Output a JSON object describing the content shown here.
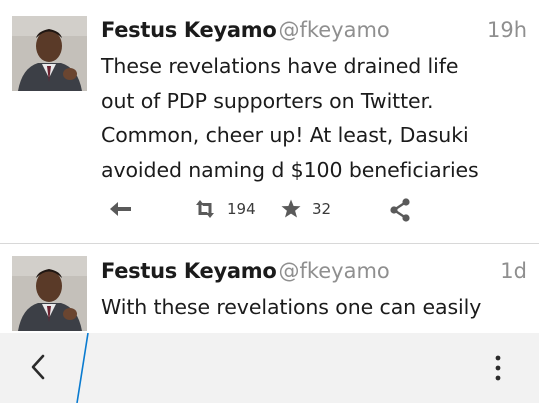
{
  "tweets": [
    {
      "name": "Festus Keyamo",
      "handle": "@fkeyamo",
      "time": "19h",
      "lines": [
        "These revelations have drained life",
        "out of PDP supporters on Twitter.",
        "Common, cheer up! At least, Dasuki",
        "avoided naming d $100 beneficiaries"
      ],
      "retweets": "194",
      "favorites": "32"
    },
    {
      "name": "Festus Keyamo",
      "handle": "@fkeyamo",
      "time": "1d",
      "lines": [
        "With these revelations one can easily"
      ]
    }
  ],
  "icons": {
    "reply": "reply-icon",
    "retweet": "retweet-icon",
    "favorite": "star-icon",
    "share": "share-icon",
    "back": "chevron-left-icon",
    "more": "more-vertical-icon"
  },
  "colors": {
    "text": "#1b1b1b",
    "muted": "#8f8f8f",
    "icon": "#5a5a5a",
    "accent": "#0a7bd0",
    "bar": "#f2f2f2"
  }
}
